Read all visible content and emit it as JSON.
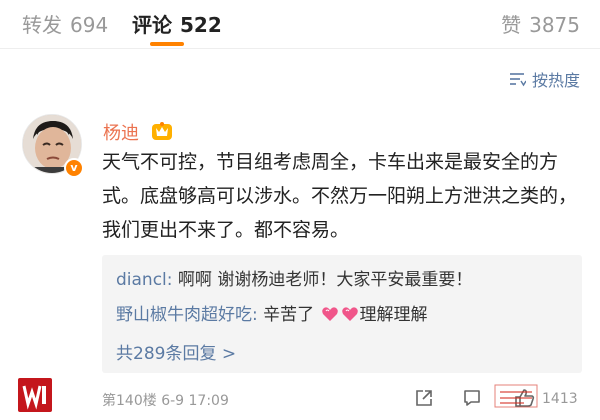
{
  "tabs": {
    "repost": {
      "label": "转发",
      "count": "694"
    },
    "comment": {
      "label": "评论",
      "count": "522"
    },
    "like": {
      "label": "赞",
      "count": "3875"
    }
  },
  "sort": {
    "label": "按热度",
    "icon": "sort-icon"
  },
  "comment": {
    "author": "杨迪",
    "author_badge_icon": "vip-crown-icon",
    "verified_icon": "verified-v-icon",
    "text": "天气不可控，节目组考虑周全，卡车出来是最安全的方式。底盘够高可以涉水。不然万一阳朔上方泄洪之类的，我们更出不来了。都不容易。",
    "replies": [
      {
        "author": "diancl:",
        "text": " 啊啊 谢谢杨迪老师！大家平安最重要！"
      },
      {
        "author": "野山椒牛肉超好吃:",
        "text": " 辛苦了 ",
        "text_after": "理解理解",
        "emoji": "heart-emoji"
      }
    ],
    "more_replies": "共289条回复 >",
    "floor": "第140楼",
    "time": "6-9 17:09",
    "like_count": "1413"
  },
  "colors": {
    "accent": "#ff8200",
    "link": "#5b7aa3",
    "username": "#eb7350",
    "muted": "#999999"
  }
}
